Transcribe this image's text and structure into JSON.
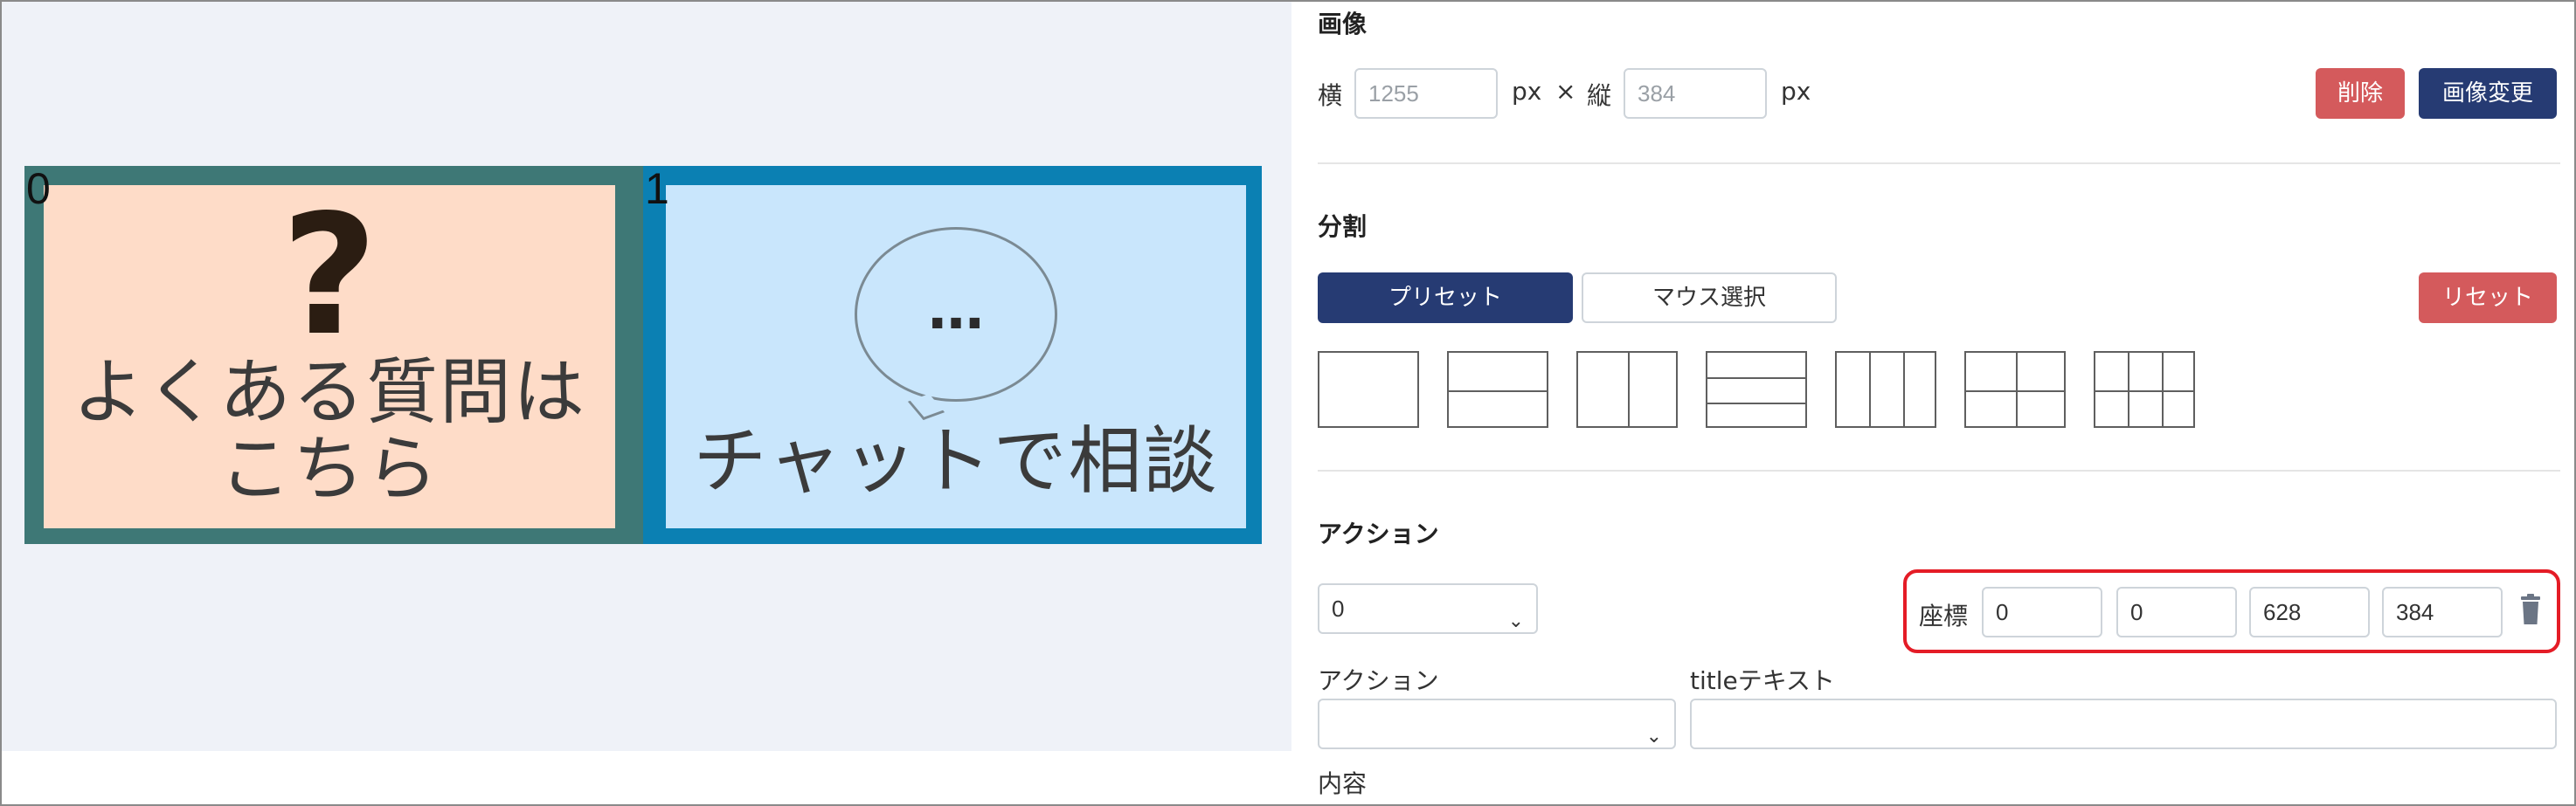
{
  "preview": {
    "areas": [
      {
        "index": "0",
        "question_mark": "?",
        "text": "よくある質問は\nこちら"
      },
      {
        "index": "1",
        "bubble_text": "…",
        "text": "チャットで相談"
      }
    ]
  },
  "image_section": {
    "title": "画像",
    "width_label": "横",
    "width_value": "1255",
    "unit1": "px",
    "times": "×",
    "height_label": "縦",
    "height_value": "384",
    "unit2": "px",
    "delete_label": "削除",
    "change_label": "画像変更"
  },
  "split_section": {
    "title": "分割",
    "preset_label": "プリセット",
    "mouse_label": "マウス選択",
    "reset_label": "リセット",
    "presets": [
      "1",
      "2-rows",
      "2-cols",
      "3-rows",
      "3-cols",
      "2x2",
      "3x2"
    ]
  },
  "action_section": {
    "title": "アクション",
    "area_select_value": "0",
    "coord_label": "座標",
    "coords": [
      "0",
      "0",
      "628",
      "384"
    ],
    "action_label": "アクション",
    "title_text_label": "titleテキスト",
    "content_label": "内容",
    "action_value": "",
    "title_text_value": ""
  },
  "colors": {
    "navy": "#263b73",
    "red": "#d45a5c",
    "highlight": "#e41c26",
    "faq_card": "#fedcc8",
    "chat_card": "#c9e6fc"
  },
  "icons": [
    "chevron-down-icon",
    "trash-icon"
  ]
}
